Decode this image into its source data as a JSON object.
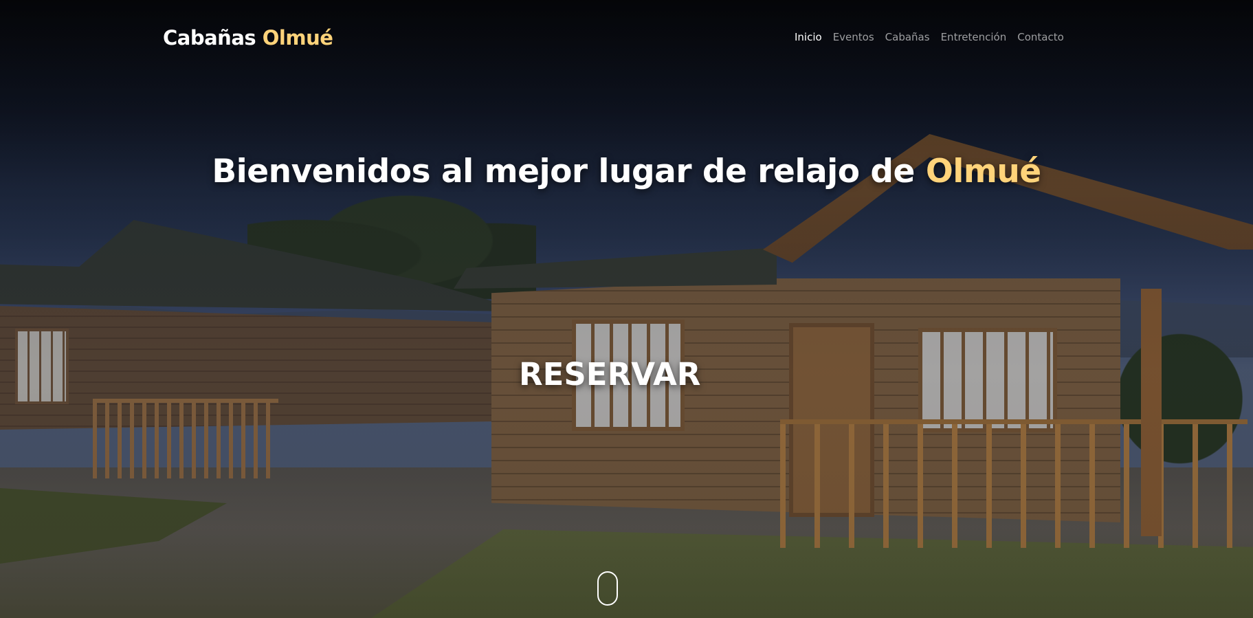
{
  "brand": {
    "name_primary": "Cabañas",
    "name_accent": "Olmué"
  },
  "nav": {
    "items": [
      {
        "label": "Inicio",
        "active": true
      },
      {
        "label": "Eventos",
        "active": false
      },
      {
        "label": "Cabañas",
        "active": false
      },
      {
        "label": "Entretención",
        "active": false
      },
      {
        "label": "Contacto",
        "active": false
      }
    ]
  },
  "hero": {
    "headline_main": "Bienvenidos al mejor lugar de relajo de",
    "headline_accent": "Olmué",
    "cta_label": "RESERVAR",
    "background_description": "wooden-cabins-photo"
  },
  "colors": {
    "accent": "#ffd37a",
    "text": "#ffffff",
    "nav_inactive": "rgba(255,255,255,0.6)"
  },
  "icons": {
    "scroll": "mouse-scroll-icon"
  }
}
